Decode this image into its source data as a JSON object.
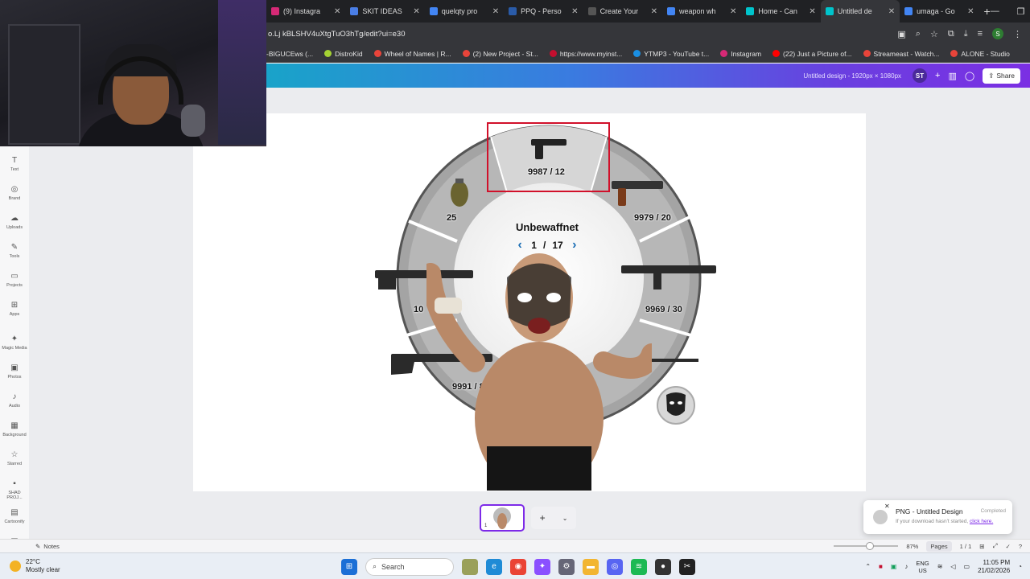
{
  "browser": {
    "tabs": [
      {
        "label": "(9) Instagra",
        "color": "#d62976"
      },
      {
        "label": "SKIT IDEAS",
        "color": "#4a7ee6"
      },
      {
        "label": "quelqty pro",
        "color": "#4285f4"
      },
      {
        "label": "PPQ - Perso",
        "color": "#2a5ba8"
      },
      {
        "label": "Create Your",
        "color": "#333333"
      },
      {
        "label": "weapon wh",
        "color": "#4285f4"
      },
      {
        "label": "Home - Can",
        "color": "#00c4cc"
      },
      {
        "label": "Untitled de",
        "color": "#00c4cc",
        "active": true
      },
      {
        "label": "umaga - Go",
        "color": "#4285f4"
      }
    ],
    "address": "o.Lj kBLSHV4uXtgTuO3hTg/edit?ui=e30",
    "bookmarks": [
      {
        "label": "-BIGUCEws (...",
        "color": "#ffffff"
      },
      {
        "label": "DistroKid",
        "color": "#a4d233"
      },
      {
        "label": "Wheel of Names | R...",
        "color": "#e8443a"
      },
      {
        "label": "(2) New Project - St...",
        "color": "#e8443a"
      },
      {
        "label": "https://www.myinst...",
        "color": "#c40f2f"
      },
      {
        "label": "YTMP3 - YouTube t...",
        "color": "#1a8fe3"
      },
      {
        "label": "Instagram",
        "color": "#d62976"
      },
      {
        "label": "(22) Just a Picture of...",
        "color": "#ff0000"
      },
      {
        "label": "Streameast - Watch...",
        "color": "#e8443a"
      },
      {
        "label": "ALONE - Studio",
        "color": "#e8443a"
      }
    ]
  },
  "canva": {
    "design_title": "Untitled design - 1920px × 1080px",
    "avatar_initials": "ST",
    "share_label": "Share",
    "rail": [
      {
        "icon": "T",
        "label": "Text"
      },
      {
        "icon": "◎",
        "label": "Brand"
      },
      {
        "icon": "☁",
        "label": "Uploads"
      },
      {
        "icon": "✎",
        "label": "Tools"
      },
      {
        "icon": "▭",
        "label": "Projects"
      },
      {
        "icon": "⊞",
        "label": "Apps"
      },
      {
        "icon": "✦",
        "label": "Magic Media"
      },
      {
        "icon": "▣",
        "label": "Photos"
      },
      {
        "icon": "♪",
        "label": "Audio"
      },
      {
        "icon": "▦",
        "label": "Background"
      },
      {
        "icon": "☆",
        "label": "Starred"
      },
      {
        "icon": "▪",
        "label": "SHAD PROJ..."
      },
      {
        "icon": "▤",
        "label": "Cartoonify"
      },
      {
        "icon": "▩",
        "label": ""
      }
    ],
    "wheel": {
      "center_title": "Unbewaffnet",
      "page_current": "1",
      "page_total": "17",
      "slots": [
        {
          "label": "9987 / 12"
        },
        {
          "label": "9979 / 20"
        },
        {
          "label": "9969 / 30"
        },
        {
          "label": "9991 / 8"
        },
        {
          "label": "10"
        },
        {
          "label": "25"
        }
      ]
    },
    "page_number": "1",
    "notes_label": "Notes",
    "zoom": "87%",
    "pages_label": "Pages",
    "page_count": "1 / 1"
  },
  "toast": {
    "title": "PNG - Untitled Design",
    "status": "Completed",
    "message": "If your download hasn't started,",
    "link": "click here."
  },
  "taskbar": {
    "temp": "22°C",
    "weather": "Mostly clear",
    "search_placeholder": "Search",
    "lang1": "ENG",
    "lang2": "US",
    "time": "11:05 PM",
    "date": "21/02/2026"
  }
}
